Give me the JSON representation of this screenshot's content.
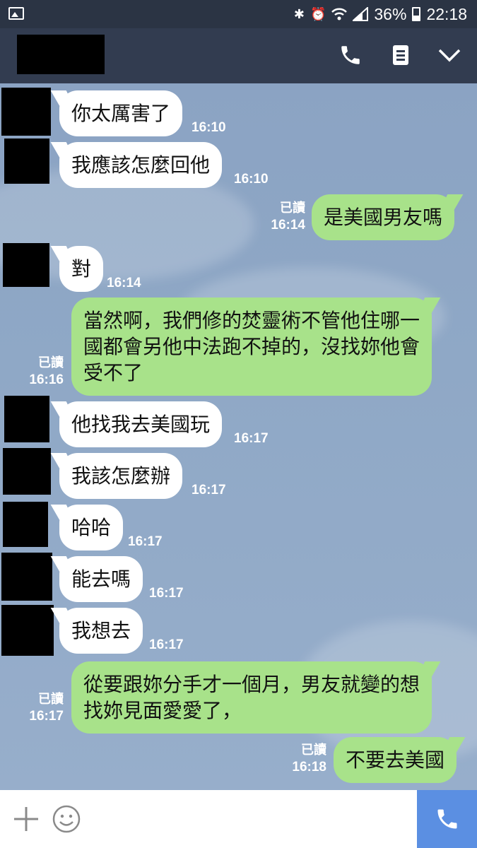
{
  "status_bar": {
    "battery": "36%",
    "time": "22:18",
    "icons": [
      "gallery-icon",
      "bluetooth-icon",
      "alarm-icon",
      "wifi-icon",
      "signal-icon",
      "battery-icon"
    ]
  },
  "header": {
    "contact_name_redacted": true,
    "icons": [
      "phone-icon",
      "menu-icon",
      "chevron-down-icon"
    ]
  },
  "messages": [
    {
      "dir": "in",
      "text": "你太厲害了",
      "time": "16:10"
    },
    {
      "dir": "in",
      "text": "我應該怎麼回他",
      "time": "16:10"
    },
    {
      "dir": "out",
      "text": "是美國男友嗎",
      "read": "已讀",
      "time": "16:14"
    },
    {
      "dir": "in",
      "text": "對",
      "time": "16:14"
    },
    {
      "dir": "out",
      "lines": [
        "當然啊，我們修的焚靈術不管他住哪一",
        "國都會另他中法跑不掉的，沒找妳他會",
        "受不了"
      ],
      "read": "已讀",
      "time": "16:16"
    },
    {
      "dir": "in",
      "text": "他找我去美國玩",
      "time": "16:17"
    },
    {
      "dir": "in",
      "text": "我該怎麼辦",
      "time": "16:17"
    },
    {
      "dir": "in",
      "text": "哈哈",
      "time": "16:17"
    },
    {
      "dir": "in",
      "text": "能去嗎",
      "time": "16:17"
    },
    {
      "dir": "in",
      "text": "我想去",
      "time": "16:17"
    },
    {
      "dir": "out",
      "lines": [
        "從要跟妳分手才一個月，男友就變的想",
        "找妳見面愛愛了，"
      ],
      "read": "已讀",
      "time": "16:17"
    },
    {
      "dir": "out",
      "text": "不要去美國",
      "read": "已讀",
      "time": "16:18"
    }
  ],
  "input_bar": {
    "icons": [
      "plus-icon",
      "emoji-icon",
      "call-icon"
    ],
    "accent": "#5b8fe2"
  },
  "colors": {
    "outgoing_bubble": "#a8e28a",
    "incoming_bubble": "#ffffff",
    "header": "#323c50"
  }
}
